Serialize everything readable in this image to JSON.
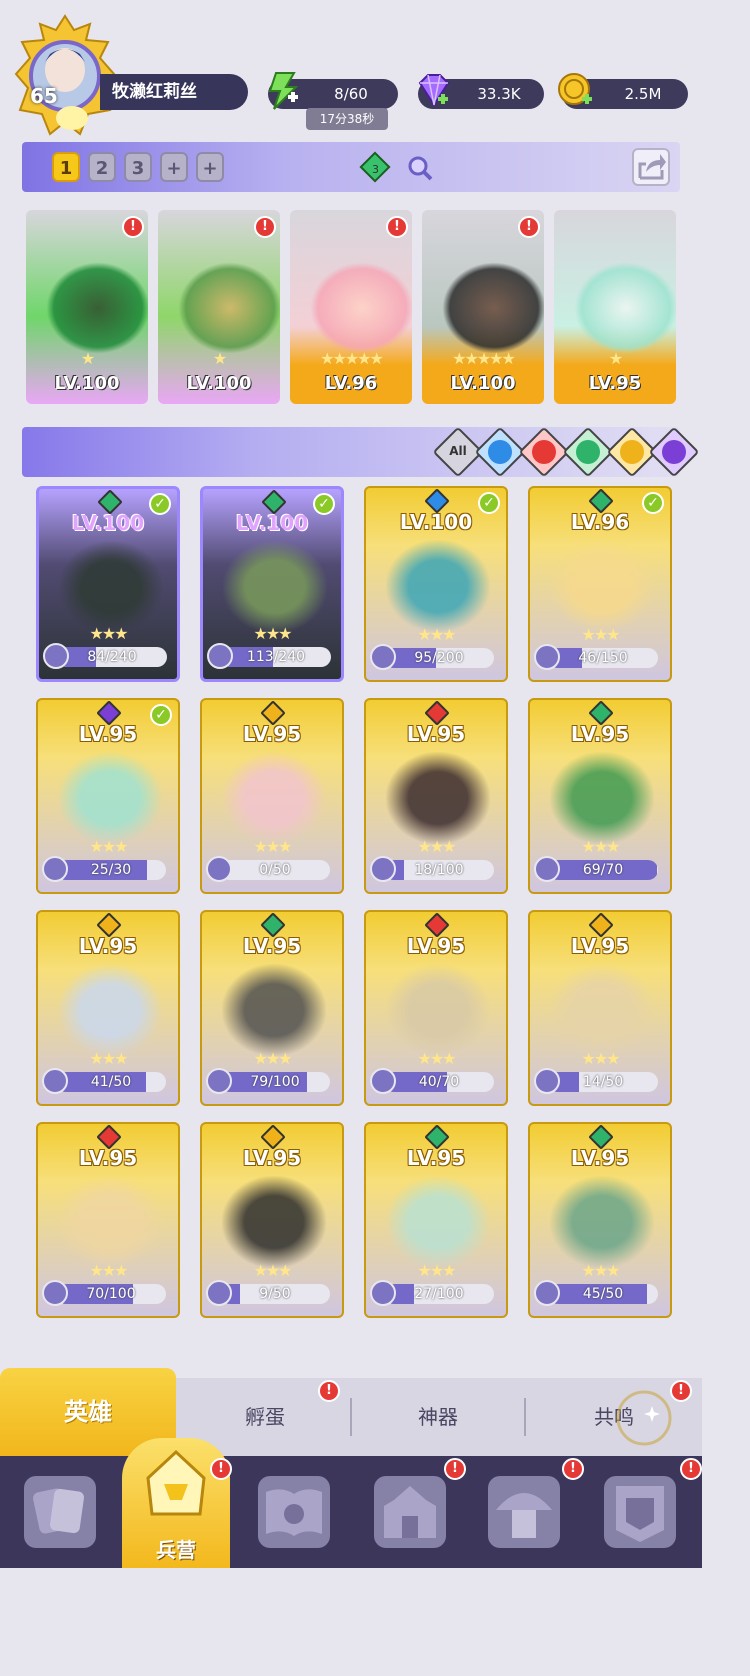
{
  "player": {
    "level": "65",
    "name": "牧濑红莉丝"
  },
  "resources": {
    "energy": {
      "value": "8/60",
      "timer": "17分38秒"
    },
    "gems": {
      "value": "33.3K"
    },
    "gold": {
      "value": "2.5M"
    }
  },
  "team": {
    "tabs": [
      "1",
      "2",
      "3",
      "+",
      "+"
    ],
    "active_tab": "1",
    "gem_count": "3",
    "slots": [
      {
        "level": "LV.100",
        "element": "green",
        "frame": "silver",
        "alert": "!"
      },
      {
        "level": "LV.100",
        "element": "green",
        "frame": "silver",
        "alert": "!"
      },
      {
        "level": "LV.96",
        "element": "green",
        "frame": "gold",
        "alert": "!"
      },
      {
        "level": "LV.100",
        "element": "blue",
        "frame": "gold",
        "alert": "!"
      },
      {
        "level": "LV.95",
        "element": "purple",
        "frame": "gold",
        "alert": ""
      }
    ]
  },
  "filters": {
    "all_label": "All",
    "elements": [
      "water-icon",
      "fire-icon",
      "wind-icon",
      "light-icon",
      "dark-icon"
    ],
    "colors": {
      "water": "#2e8be6",
      "fire": "#e53935",
      "wind": "#2fb36b",
      "light": "#f0b21a",
      "dark": "#7b3fd6"
    }
  },
  "heroes": [
    {
      "level": "LV.100",
      "fragments": "84/240",
      "progress": 0.35,
      "element": "#2fb36b",
      "style": "purple",
      "checked": true
    },
    {
      "level": "LV.100",
      "fragments": "113/240",
      "progress": 0.47,
      "element": "#2fb36b",
      "style": "purple",
      "checked": true
    },
    {
      "level": "LV.100",
      "fragments": "95/200",
      "progress": 0.475,
      "element": "#2e8be6",
      "style": "gold",
      "checked": true
    },
    {
      "level": "LV.96",
      "fragments": "46/150",
      "progress": 0.31,
      "element": "#2fb36b",
      "style": "gold",
      "checked": true
    },
    {
      "level": "LV.95",
      "fragments": "25/30",
      "progress": 0.83,
      "element": "#7b3fd6",
      "style": "gold",
      "checked": true
    },
    {
      "level": "LV.95",
      "fragments": "0/50",
      "progress": 0,
      "element": "#f0b21a",
      "style": "gold",
      "checked": false
    },
    {
      "level": "LV.95",
      "fragments": "18/100",
      "progress": 0.18,
      "element": "#e53935",
      "style": "gold",
      "checked": false
    },
    {
      "level": "LV.95",
      "fragments": "69/70",
      "progress": 0.99,
      "element": "#2fb36b",
      "style": "gold",
      "checked": false
    },
    {
      "level": "LV.95",
      "fragments": "41/50",
      "progress": 0.82,
      "element": "#f0b21a",
      "style": "gold",
      "checked": false
    },
    {
      "level": "LV.95",
      "fragments": "79/100",
      "progress": 0.79,
      "element": "#2fb36b",
      "style": "gold",
      "checked": false
    },
    {
      "level": "LV.95",
      "fragments": "40/70",
      "progress": 0.57,
      "element": "#e53935",
      "style": "gold",
      "checked": false
    },
    {
      "level": "LV.95",
      "fragments": "14/50",
      "progress": 0.28,
      "element": "#f0b21a",
      "style": "gold",
      "checked": false
    },
    {
      "level": "LV.95",
      "fragments": "70/100",
      "progress": 0.7,
      "element": "#e53935",
      "style": "gold",
      "checked": false
    },
    {
      "level": "LV.95",
      "fragments": "9/50",
      "progress": 0.18,
      "element": "#f0b21a",
      "style": "gold",
      "checked": false
    },
    {
      "level": "LV.95",
      "fragments": "27/100",
      "progress": 0.27,
      "element": "#2fb36b",
      "style": "gold",
      "checked": false
    },
    {
      "level": "LV.95",
      "fragments": "45/50",
      "progress": 0.9,
      "element": "#2fb36b",
      "style": "gold",
      "checked": false
    }
  ],
  "subtabs": {
    "heroes": "英雄",
    "hatch": "孵蛋",
    "artifacts": "神器",
    "resonance": "共鸣"
  },
  "bottom_nav": {
    "barracks_label": "兵营",
    "alert": "!"
  }
}
